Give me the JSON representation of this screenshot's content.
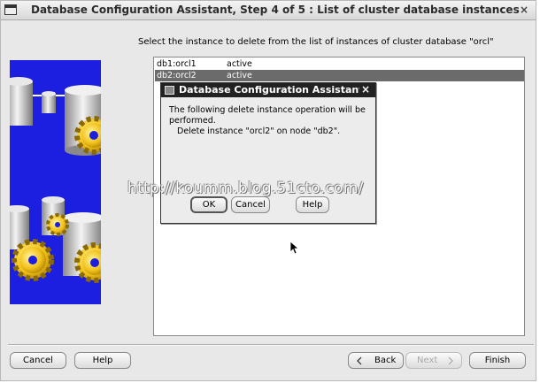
{
  "window": {
    "title": "Database Configuration Assistant, Step 4 of 5 : List of cluster database instances",
    "close_glyph": "×"
  },
  "main": {
    "instruction": "Select the instance to delete from the list of instances of cluster database \"orcl\"",
    "instances": [
      {
        "name": "db1:orcl1",
        "status": "active",
        "selected": false
      },
      {
        "name": "db2:orcl2",
        "status": "active",
        "selected": true
      }
    ]
  },
  "dialog": {
    "title": "Database Configuration Assistant",
    "close_glyph": "×",
    "message_line1": "The following delete instance operation will be",
    "message_line2": "performed.",
    "message_line3": "Delete instance \"orcl2\" on node \"db2\".",
    "ok_label": "OK",
    "cancel_label": "Cancel",
    "help_label": "Help"
  },
  "footer": {
    "cancel_label": "Cancel",
    "help_label": "Help",
    "back_label": "Back",
    "next_label": "Next",
    "finish_label": "Finish"
  },
  "watermark": "http://koumm.blog.51cto.com/",
  "colors": {
    "art_background": "#1c1ee0",
    "selection": "#6b6b6b",
    "dialog_title": "#222222"
  },
  "icons": [
    "window-icon",
    "close-icon",
    "back-arrow-icon",
    "next-arrow-icon",
    "mouse-cursor-icon",
    "database-cylinder-icon",
    "gear-icon"
  ]
}
